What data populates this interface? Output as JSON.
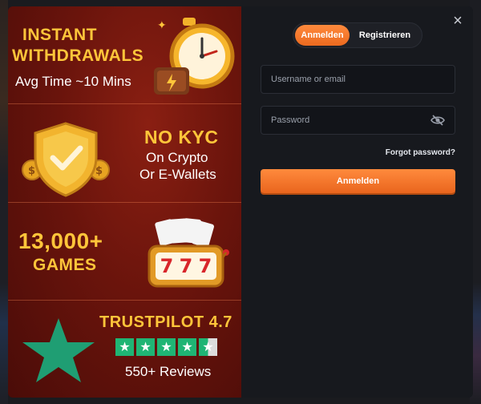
{
  "promo": {
    "withdrawals": {
      "title_line1": "INSTANT",
      "title_line2": "WITHDRAWALS",
      "subtitle": "Avg Time ~10 Mins"
    },
    "kyc": {
      "title": "NO KYC",
      "line1": "On Crypto",
      "line2": "Or E-Wallets"
    },
    "games": {
      "count": "13,000+",
      "label": "GAMES",
      "reels": [
        "7",
        "7",
        "7"
      ]
    },
    "trustpilot": {
      "title": "TRUSTPILOT 4.7",
      "rating": 4.7,
      "star_glyph": "★",
      "reviews": "550+ Reviews"
    }
  },
  "login": {
    "close_icon": "×",
    "tabs": [
      {
        "label": "Anmelden",
        "active": true
      },
      {
        "label": "Registrieren",
        "active": false
      }
    ],
    "username": {
      "value": "",
      "placeholder": "Username or email"
    },
    "password": {
      "value": "",
      "placeholder": "Password"
    },
    "forgot_label": "Forgot password?",
    "submit_label": "Anmelden"
  },
  "colors": {
    "accent": "#f07428",
    "gold": "#ffc53a",
    "trustpilot_green": "#1fb574",
    "promo_bg": "#6a140c",
    "panel_bg": "#17191e"
  }
}
